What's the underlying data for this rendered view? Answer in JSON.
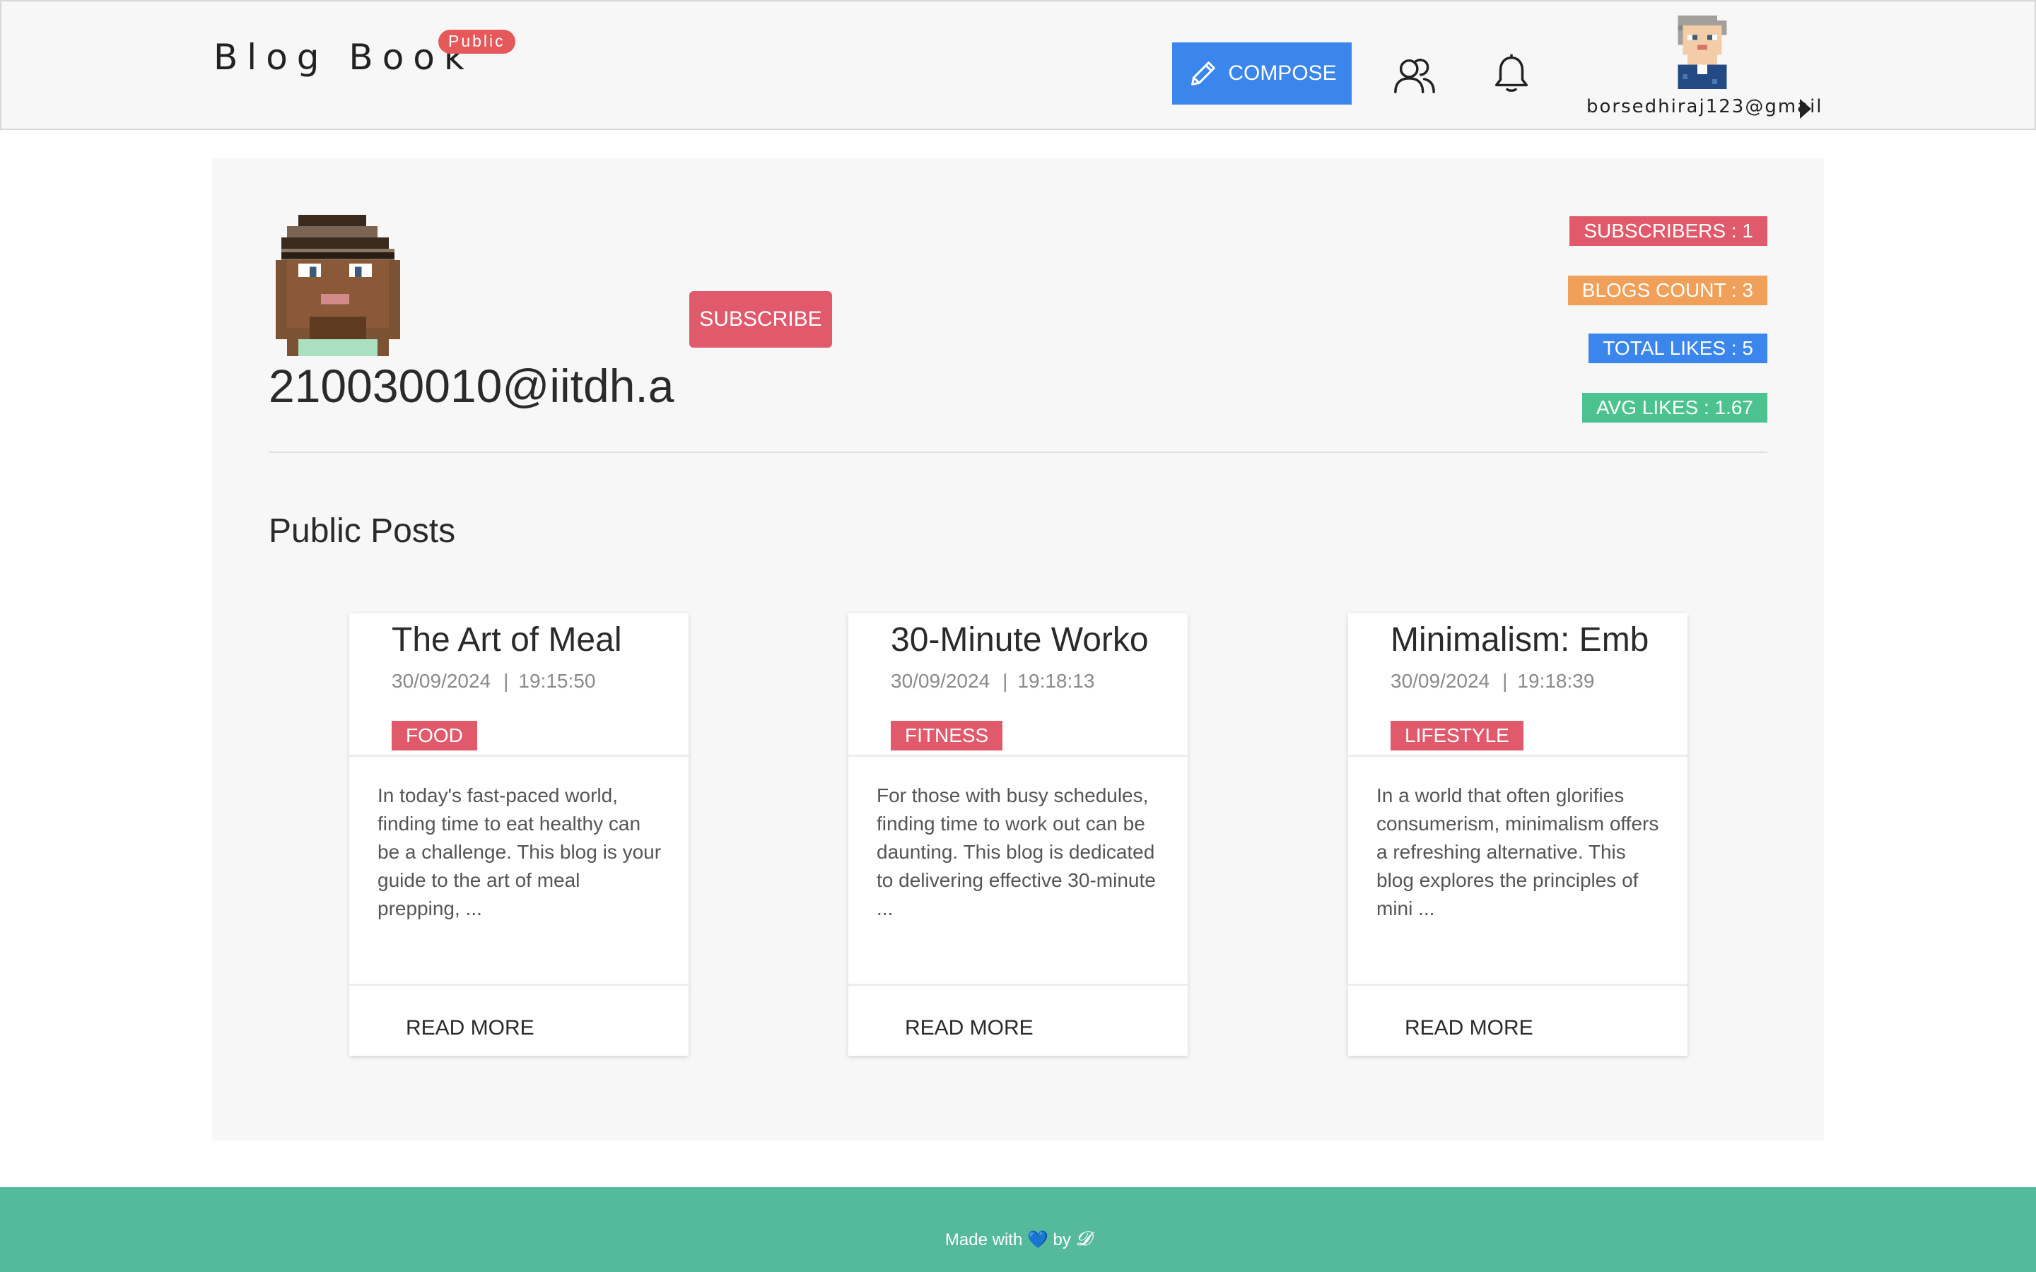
{
  "header": {
    "brand": "Blog Book",
    "brand_badge": "Public",
    "compose_label": "COMPOSE",
    "user_email": "borsedhiraj123@gmail",
    "icons": [
      "pencil-icon",
      "people-icon",
      "bell-icon",
      "caret-right-icon"
    ]
  },
  "profile": {
    "name": "210030010@iitdh.a",
    "subscribe_label": "SUBSCRIBE",
    "stats": {
      "subscribers": "SUBSCRIBERS : 1",
      "blogs_count": "BLOGS COUNT : 3",
      "total_likes": "TOTAL LIKES : 5",
      "avg_likes": "AVG LIKES : 1.67"
    }
  },
  "posts": {
    "section_title": "Public Posts",
    "items": [
      {
        "title": "The Art of Meal",
        "date": "30/09/2024",
        "sep": "|",
        "time": "19:15:50",
        "tag": "FOOD",
        "excerpt": "In today's fast-paced world, finding time to eat healthy can be a challenge. This blog is your guide to the art of meal prepping, ...",
        "read_more": "READ MORE"
      },
      {
        "title": "30-Minute Worko",
        "date": "30/09/2024",
        "sep": "|",
        "time": "19:18:13",
        "tag": "FITNESS",
        "excerpt": "For those with busy schedules, finding time to work out can be daunting. This blog is dedicated to delivering effective 30-minute ...",
        "read_more": "READ MORE"
      },
      {
        "title": "Minimalism: Emb",
        "date": "30/09/2024",
        "sep": "|",
        "time": "19:18:39",
        "tag": "LIFESTYLE",
        "excerpt": "In a world that often glorifies consumerism, minimalism offers a refreshing alternative. This blog explores the principles of mini ...",
        "read_more": "READ MORE"
      }
    ]
  },
  "footer": {
    "made_with": "Made with",
    "heart": "💙",
    "by": "by",
    "signature": "𝓓"
  },
  "colors": {
    "primary": "#3a86ec",
    "danger": "#e05a6b",
    "warning": "#f0a058",
    "success": "#4cc38f",
    "footer": "#55b99c"
  }
}
